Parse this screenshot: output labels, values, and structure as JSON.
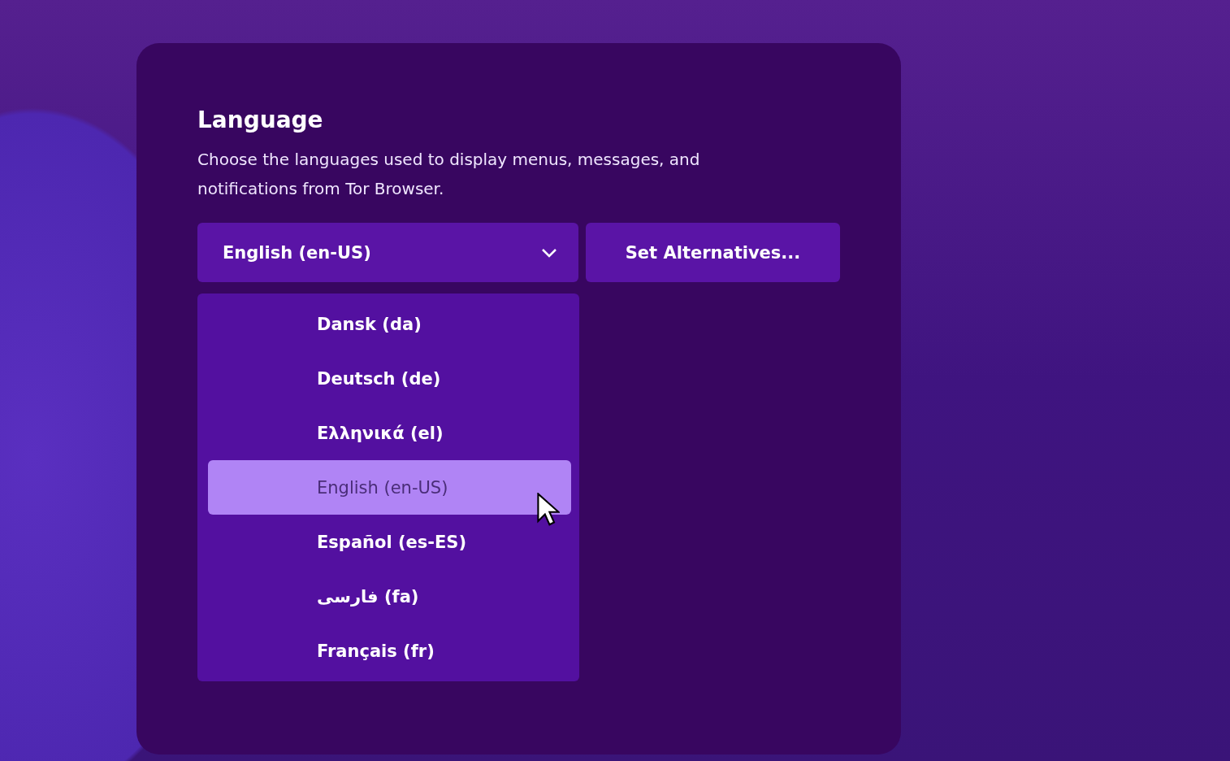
{
  "title": "Language",
  "description": "Choose the languages used to display menus, messages, and notifications from Tor Browser.",
  "language_select": {
    "value": "English (en-US)",
    "expanded": true
  },
  "alternatives_button": "Set Alternatives...",
  "options": [
    {
      "label": "Dansk (da)",
      "selected": false
    },
    {
      "label": "Deutsch (de)",
      "selected": false
    },
    {
      "label": "Ελληνικά (el)",
      "selected": false
    },
    {
      "label": "English (en-US)",
      "selected": true
    },
    {
      "label": "Español (es-ES)",
      "selected": false
    },
    {
      "label": "فارسی (fa)",
      "selected": false
    },
    {
      "label": "Français (fr)",
      "selected": false
    }
  ]
}
